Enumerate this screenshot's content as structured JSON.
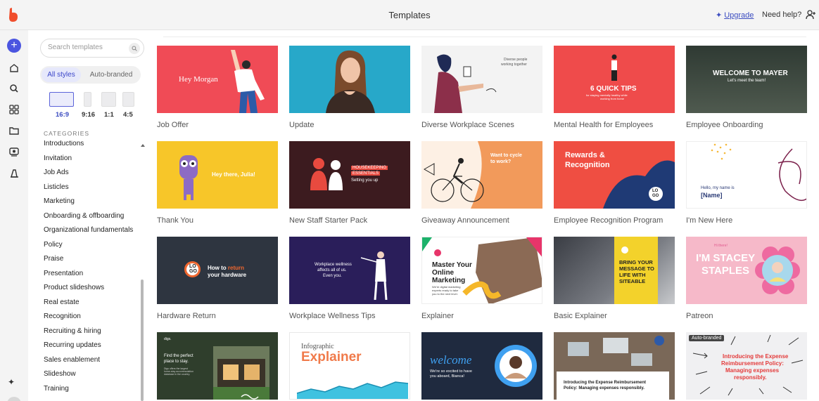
{
  "header": {
    "title": "Templates",
    "upgrade": "Upgrade",
    "help": "Need help?"
  },
  "sidebar": {
    "search_placeholder": "Search templates",
    "styles": [
      "All styles",
      "Auto-branded"
    ],
    "ratios": [
      "16:9",
      "9:16",
      "1:1",
      "4:5"
    ],
    "categories_heading": "CATEGORIES",
    "categories": [
      "Introductions",
      "Invitation",
      "Job Ads",
      "Listicles",
      "Marketing",
      "Onboarding & offboarding",
      "Organizational fundamentals",
      "Policy",
      "Praise",
      "Presentation",
      "Product slideshows",
      "Real estate",
      "Recognition",
      "Recruiting & hiring",
      "Recurring updates",
      "Sales enablement",
      "Slideshow",
      "Training"
    ]
  },
  "templates": [
    {
      "name": "Job Offer",
      "thumb_text": [
        "Hey Morgan"
      ]
    },
    {
      "name": "Update",
      "thumb_text": []
    },
    {
      "name": "Diverse Workplace Scenes",
      "thumb_text": [
        "Diverse people",
        "working together"
      ]
    },
    {
      "name": "Mental Health for Employees",
      "thumb_text": [
        "6 QUICK TIPS",
        "for staying mentally healthy while",
        "working from home"
      ]
    },
    {
      "name": "Employee Onboarding",
      "thumb_text": [
        "WELCOME TO MAYER",
        "Let's meet the team!"
      ]
    },
    {
      "name": "Thank You",
      "thumb_text": [
        "Hey there, Julia!"
      ]
    },
    {
      "name": "New Staff Starter Pack",
      "thumb_text": [
        "HOUSEKEEPING",
        "ESSENTIALS",
        "Setting you up"
      ]
    },
    {
      "name": "Giveaway Announcement",
      "thumb_text": [
        "Want to cycle",
        "to work?"
      ]
    },
    {
      "name": "Employee Recognition Program",
      "thumb_text": [
        "Rewards &",
        "Recognition",
        "LO",
        "GO"
      ]
    },
    {
      "name": "I'm New Here",
      "thumb_text": [
        "Hello, my name is",
        "[Name]"
      ]
    },
    {
      "name": "Hardware Return",
      "thumb_text": [
        "How to ",
        "return",
        "your hardware",
        "LO",
        "GO"
      ]
    },
    {
      "name": "Workplace Wellness Tips",
      "thumb_text": [
        "Workplace wellness",
        "affects all of us.",
        "Even you."
      ]
    },
    {
      "name": "Explainer",
      "thumb_text": [
        "Master Your",
        "Online",
        "Marketing",
        "We're digital marketing",
        "experts ready to take",
        "you to the next level."
      ]
    },
    {
      "name": "Basic Explainer",
      "thumb_text": [
        "BRING YOUR",
        "MESSAGE TO",
        "LIFE WITH",
        "SITEABLE"
      ]
    },
    {
      "name": "Patreon",
      "thumb_text": [
        "Hi there!",
        "I'M STACEY",
        "STAPLES"
      ]
    },
    {
      "name": "",
      "thumb_text": [
        "digs.",
        "Find the perfect",
        "place to stay.",
        "Digs offers the largest",
        "home-stay accommodation",
        "database in the country."
      ]
    },
    {
      "name": "",
      "thumb_text": [
        "Infographic",
        "Explainer"
      ]
    },
    {
      "name": "",
      "thumb_text": [
        "welcome",
        "We're so excited to have",
        "you aboard, Bianca!"
      ]
    },
    {
      "name": "",
      "thumb_text": [
        "Introducing the Expense Reimbursement",
        "Policy: Managing expenses responsibly."
      ]
    },
    {
      "name": "",
      "badge": "Auto-branded",
      "thumb_text": [
        "Introducing the Expense",
        "Reimbursement Policy:",
        "Managing expenses",
        "responsibly."
      ]
    }
  ],
  "colors": {
    "accent": "#4b55e0",
    "brand": "#f04e2d"
  }
}
